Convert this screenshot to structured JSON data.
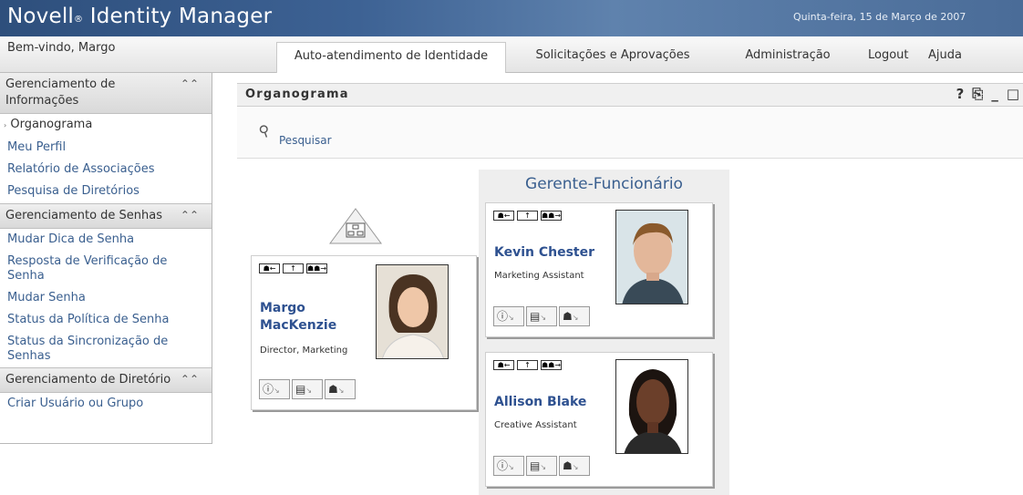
{
  "header": {
    "brand": "Novell",
    "brand_mark": "®",
    "product": "Identity Manager",
    "date": "Quinta-feira, 15 de Março de 2007"
  },
  "topbar": {
    "welcome": "Bem-vindo, Margo",
    "tabs": [
      {
        "label": "Auto-atendimento de Identidade",
        "active": true
      },
      {
        "label": "Solicitações e Aprovações",
        "active": false
      },
      {
        "label": "Administração",
        "active": false
      },
      {
        "label": "Logout",
        "active": false
      },
      {
        "label": "Ajuda",
        "active": false
      }
    ]
  },
  "sidebar": {
    "sections": [
      {
        "title": "Gerenciamento de Informações",
        "items": [
          "Organograma",
          "Meu Perfil",
          "Relatório de Associações",
          "Pesquisa de Diretórios"
        ]
      },
      {
        "title": "Gerenciamento de Senhas",
        "items": [
          "Mudar Dica de Senha",
          "Resposta de Verificação de Senha",
          "Mudar Senha",
          "Status da Política de Senha",
          "Status da Sincronização de Senhas"
        ]
      },
      {
        "title": "Gerenciamento de Diretório",
        "items": [
          "Criar Usuário ou Grupo"
        ]
      }
    ],
    "current": "Organograma",
    "collapse_icon": "double-chevron-up-icon"
  },
  "portlet": {
    "title": "Organograma",
    "controls": [
      "?",
      "print-icon",
      "minimize-icon",
      "maximize-icon"
    ],
    "search_label": "Pesquisar"
  },
  "orgchart": {
    "relationship_title": "Gerente-Funcionário",
    "manager": {
      "first": "Margo",
      "last": "MacKenzie",
      "title": "Director, Marketing"
    },
    "reports": [
      {
        "name": "Kevin Chester",
        "title": "Marketing Assistant"
      },
      {
        "name": "Allison Blake",
        "title": "Creative Assistant"
      }
    ],
    "card_nav_icons": [
      "show-manager-icon",
      "move-up-icon",
      "show-reports-icon"
    ],
    "card_action_icons": [
      "info-icon",
      "email-icon",
      "org-relationship-icon"
    ]
  },
  "colors": {
    "header_bg": "#3d6294",
    "link": "#3a5f8f",
    "name": "#2e5190",
    "manager_column_bg": "#eeeeee"
  }
}
